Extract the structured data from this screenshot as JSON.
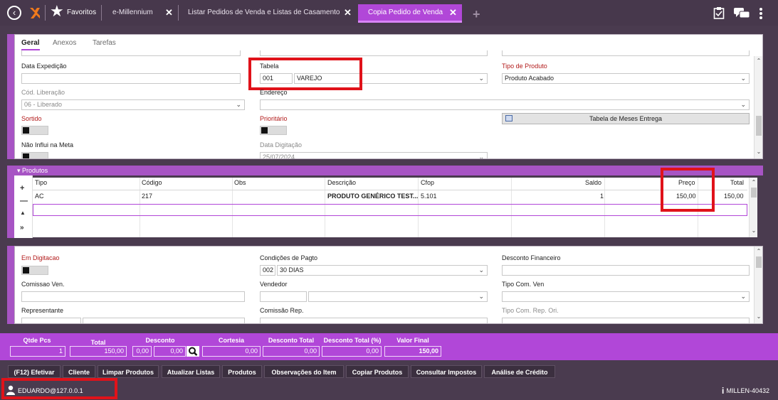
{
  "topbar": {
    "favorites_label": "Favoritos",
    "tabs": [
      {
        "label": "e-Millennium",
        "close": "✕"
      },
      {
        "label": "Listar Pedidos de Venda e Listas de Casamento",
        "close": "✕"
      },
      {
        "label": "Copia Pedido de Venda",
        "close": "✕"
      }
    ],
    "add_tab": "+",
    "accent_color": "#b147d8"
  },
  "subtabs": [
    "Geral",
    "Anexos",
    "Tarefas"
  ],
  "geral": {
    "data_expedicao_label": "Data Expedição",
    "data_expedicao_value": "",
    "tabela_label": "Tabela",
    "tabela_code": "001",
    "tabela_name": "VAREJO",
    "tipo_produto_label": "Tipo de Produto",
    "tipo_produto_value": "Produto Acabado",
    "cod_liberacao_label": "Cód. Liberação",
    "cod_liberacao_value": "06 - Liberado",
    "endereco_label": "Endereço",
    "endereco_value": "",
    "tabela_meses_button": "Tabela de Meses Entrega",
    "sortido_label": "Sortido",
    "prioritario_label": "Prioritário",
    "nao_influi_label": "Não Influi na Meta",
    "data_digitacao_label": "Data Digitação",
    "data_digitacao_value": "25/07/2024"
  },
  "produtos": {
    "header": "Produtos",
    "columns": [
      "Tipo",
      "Código",
      "Obs",
      "Descrição",
      "Cfop",
      "Saldo",
      "Preço",
      "Total"
    ],
    "rows": [
      {
        "tipo": "AC",
        "codigo": "217",
        "obs": "",
        "descricao": "PRODUTO GENÉRICO TEST...",
        "cfop": "5.101",
        "saldo": "1",
        "preco": "150,00",
        "total": "150,00"
      }
    ],
    "side_buttons": [
      "+",
      "—",
      "▲",
      "»"
    ]
  },
  "pagamento": {
    "em_digitacao_label": "Em Digitacao",
    "condicoes_label": "Condições de Pagto",
    "condicoes_code": "002",
    "condicoes_name": "30 DIAS",
    "desconto_fin_label": "Desconto Financeiro",
    "desconto_fin_value": "",
    "comissao_ven_label": "Comissao Ven.",
    "vendedor_label": "Vendedor",
    "tipo_com_ven_label": "Tipo Com. Ven",
    "representante_label": "Representante",
    "comissao_rep_label": "Comissão Rep.",
    "tipo_com_rep_label": "Tipo Com. Rep. Ori."
  },
  "totals": {
    "qtde_pcs_label": "Qtde Pcs",
    "qtde_pcs": "1",
    "total_label": "Total",
    "total": "150,00",
    "desconto_label": "Desconto",
    "desconto_pct": "0,00",
    "desconto_val": "0,00",
    "cortesia_label": "Cortesia",
    "cortesia": "0,00",
    "desconto_total_label": "Desconto Total",
    "desconto_total": "0,00",
    "desconto_total_pct_label": "Desconto Total (%)",
    "desconto_total_pct": "0,00",
    "valor_final_label": "Valor Final",
    "valor_final": "150,00"
  },
  "actions": [
    "(F12) Efetivar",
    "Cliente",
    "Limpar Produtos",
    "Atualizar Listas",
    "Produtos",
    "Observações do Item",
    "Copiar Produtos",
    "Consultar Impostos",
    "Análise de Crédito"
  ],
  "status": {
    "user": "EDUARDO@127.0.0.1",
    "server": "MILLEN-40432"
  }
}
